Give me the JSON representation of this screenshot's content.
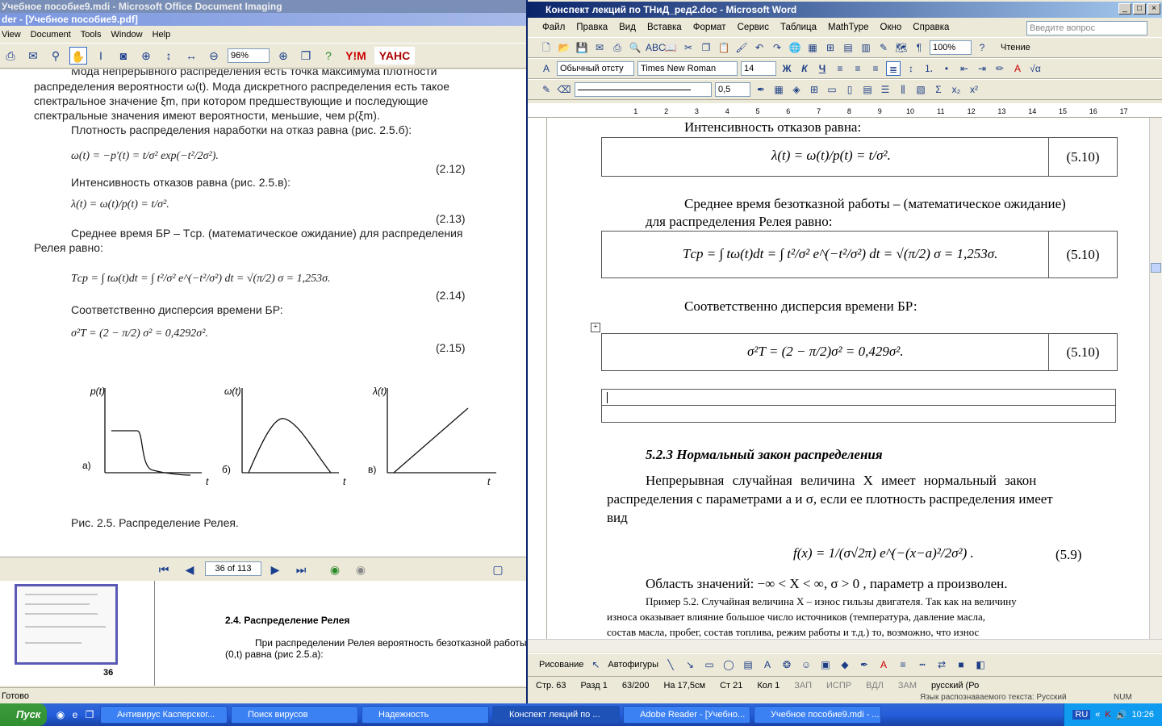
{
  "reader": {
    "title_back": "Учебное пособие9.mdi - Microsoft Office Document Imaging",
    "title": "der - [Учебное пособие9.pdf]",
    "menu": [
      "View",
      "Document",
      "Tools",
      "Window",
      "Help"
    ],
    "zoom": "96%",
    "page": {
      "lines": [
        "Мода непрерывного распределения есть точка максимума плотности",
        "распределения вероятности ω(t). Мода дискретного распределения есть такое",
        "спектральное значение ξm, при котором предшествующие и последующие",
        "спектральные значения имеют вероятности, меньшие, чем p(ξm).",
        "Плотность распределения наработки на отказ равна (рис. 2.5.б):",
        "Интенсивность отказов равна (рис. 2.5.в):",
        "Среднее время БР – Tср. (математическое ожидание) для распределения",
        "Релея равно:",
        "Соответственно дисперсия времени БР:"
      ],
      "formulas": [
        "ω(t) = −p′(t) = t/σ² exp(−t²/2σ²).",
        "λ(t) = ω(t)/p(t) = t/σ².",
        "Tср = ∫ tω(t)dt = ∫ t²/σ² e^(−t²/σ²) dt = √(π/2) σ = 1,253σ.",
        "σ²T = (2 − π/2) σ² = 0,4292σ²."
      ],
      "eq_numbers": [
        "(2.12)",
        "(2.13)",
        "(2.14)",
        "(2.15)"
      ],
      "plots": [
        {
          "y_label": "p(t)",
          "x_label": "t",
          "letter": "а)"
        },
        {
          "y_label": "ω(t)",
          "x_label": "t",
          "letter": "б)"
        },
        {
          "y_label": "λ(t)",
          "x_label": "t",
          "letter": "в)"
        }
      ],
      "caption": "Рис. 2.5. Распределение Релея."
    },
    "nav_page": "36 of 113",
    "thumb_number": "36",
    "lower_heading": "2.4. Распределение Релея",
    "lower_text1": "При распределении Релея вероятность безотказной работы",
    "lower_text2": "(0,t) равна (рис 2.5.а):",
    "status": "Готово"
  },
  "word": {
    "title": "Конспект лекций по ТНиД_ред2.doc - Microsoft Word",
    "menu": [
      "Файл",
      "Правка",
      "Вид",
      "Вставка",
      "Формат",
      "Сервис",
      "Таблица",
      "MathType",
      "Окно",
      "Справка"
    ],
    "help_placeholder": "Введите вопрос",
    "zoom": "100%",
    "reading": "Чтение",
    "style": "Обычный отсту",
    "font": "Times New Roman",
    "size": "14",
    "line_width": "0,5",
    "doc": {
      "p1": "Интенсивность отказов равна:",
      "f1": "λ(t) = ω(t)/p(t) = t/σ².",
      "n1": "(5.10)",
      "p2a": "Среднее время безотказной работы – (математическое ожидание)",
      "p2b": "для распределения Релея равно:",
      "f2": "Tср = ∫ tω(t)dt = ∫ t²/σ² e^(−t²/σ²) dt = √(π/2) σ = 1,253σ.",
      "n2": "(5.10)",
      "p3": "Соответственно дисперсия времени БР:",
      "f3": "σ²T = (2 − π/2)σ² = 0,429σ².",
      "n3": "(5.10)",
      "heading": "5.2.3 Нормальный закон распределения",
      "p4a": "Непрерывная случайная величина X имеет нормальный закон",
      "p4b": "распределения с параметрами a и σ, если ее плотность распределения имеет",
      "p4c": "вид",
      "f4": "f(x) = 1/(σ√2π) e^(−(x−a)²/2σ²) .",
      "n4": "(5.9)",
      "p5": "Область значений: −∞ < X < ∞, σ > 0 , параметр a произволен.",
      "p6a": "Пример 5.2. Случайная величина X – износ гильзы двигателя. Так как на величину",
      "p6b": "износа оказывает влияние большое число источников (температура, давление масла,",
      "p6c": "состав масла, пробег, состав топлива, режим работы и т.д.) то, возможно, что износ"
    },
    "draw_label": "Рисование",
    "autoshapes": "Автофигуры",
    "status": {
      "page": "Стр. 63",
      "section": "Разд 1",
      "count": "63/200",
      "at": "На 17,5см",
      "line": "Ст 21",
      "col": "Кол 1",
      "rec": "ЗАП",
      "trk": "ИСПР",
      "ext": "ВДЛ",
      "ovr": "ЗАМ",
      "lang": "русский (Ро"
    },
    "ocr_lang": "Язык распознаваемого текста: Русский",
    "ocr_mode": "NUM"
  },
  "taskbar": {
    "start": "Пуск",
    "tasks": [
      "Антивирус Касперског...",
      "Поиск вирусов",
      "Надежность",
      "Конспект лекций по ...",
      "Adobe Reader - [Учебно...",
      "Учебное пособие9.mdi - ..."
    ],
    "lang": "RU",
    "clock": "10:26"
  }
}
